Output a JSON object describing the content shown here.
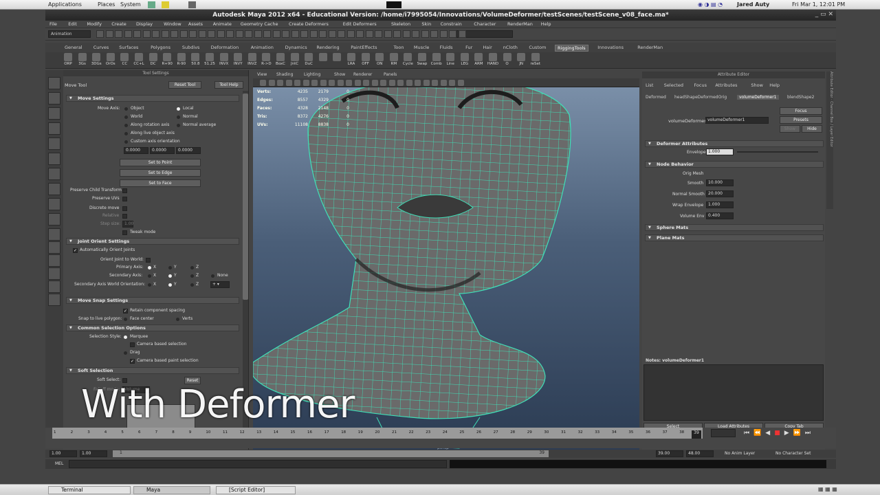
{
  "top_panel": {
    "applications": "Applications",
    "places": "Places",
    "system": "System",
    "user": "Jared Auty",
    "clock": "Fri Mar 1, 12:01 PM"
  },
  "window": {
    "title": "Autodesk Maya 2012 x64 - Educational Version: /home/i7995054/Innovations/VolumeDeformer/testScenes/testScene_v08_face.ma*"
  },
  "menu": [
    "File",
    "Edit",
    "Modify",
    "Create",
    "Display",
    "Window",
    "Assets",
    "Animate",
    "Geometry Cache",
    "Create Deformers",
    "Edit Deformers",
    "Skeleton",
    "Skin",
    "Constrain",
    "Character",
    "RenderMan",
    "Help"
  ],
  "status": {
    "mode": "Animation"
  },
  "shelf_tabs": [
    "General",
    "Curves",
    "Surfaces",
    "Polygons",
    "Subdivs",
    "Deformation",
    "Animation",
    "Dynamics",
    "Rendering",
    "PaintEffects",
    "Toon",
    "Muscle",
    "Fluids",
    "Fur",
    "Hair",
    "nCloth",
    "Custom",
    "RiggingTools",
    "Innovations",
    "RenderMan"
  ],
  "shelf_active": "RiggingTools",
  "shelf_items": [
    "ORP",
    "3Gs",
    "3DGs",
    "OrOs",
    "CC",
    "CC+L",
    "DC",
    "R+90",
    "R-90",
    "50.8",
    "51.25",
    "INVX",
    "INVY",
    "INVZ",
    "R->D",
    "BoxC",
    "JntC",
    "DuC",
    "",
    "",
    "LRA",
    "OFF",
    "ON",
    "RM",
    "Cycle",
    "Swap",
    "Comb",
    "Line",
    "LEG",
    "ARM",
    "HAND",
    "O",
    "JN",
    "reSet"
  ],
  "tool_settings": {
    "panel_title": "Tool Settings",
    "tool_name": "Move Tool",
    "reset": "Reset Tool",
    "help": "Tool Help",
    "move_settings": "Move Settings",
    "move_axis": "Move Axis:",
    "axes": [
      "Object",
      "Local",
      "World",
      "Normal",
      "Along rotation axis",
      "Normal average",
      "Along live object axis",
      "Custom axis orientation"
    ],
    "vals": [
      "0.0000",
      "0.0000",
      "0.0000"
    ],
    "set_points": "Set to Point",
    "set_edge": "Set to Edge",
    "set_face": "Set to Face",
    "preserve_child": "Preserve Child Transform",
    "preserve_uvs": "Preserve UVs",
    "discrete": "Discrete move",
    "relative": "Relative",
    "step_size": "Step size:",
    "step_val": "1.00",
    "tweak": "Tweak mode",
    "joint_orient": "Joint Orient Settings",
    "auto_orient": "Automatically Orient Joints",
    "orient_world": "Orient Joint to World:",
    "primary": "Primary Axis:",
    "secondary": "Secondary Axis:",
    "sec_world": "Secondary Axis World Orientation:",
    "x": "X",
    "y": "Y",
    "z": "Z",
    "none": "None",
    "move_snap": "Move Snap Settings",
    "retain": "Retain component spacing",
    "snap_live": "Snap to live polygon:",
    "face_center": "Face center",
    "verts": "Verts",
    "common_sel": "Common Selection Options",
    "sel_style": "Selection Style:",
    "marquee": "Marquee",
    "cam_sel": "Camera based selection",
    "drag": "Drag",
    "cam_paint": "Camera based paint selection",
    "soft_sel": "Soft Selection",
    "soft_select": "Soft Select:",
    "reset_btn": "Reset",
    "falloff_mode": "Falloff mode:",
    "falloff_val": "Volume"
  },
  "viewport": {
    "menu": [
      "View",
      "Shading",
      "Lighting",
      "Show",
      "Renderer",
      "Panels"
    ],
    "hud": [
      [
        "Verts:",
        "4235",
        "2179",
        "0"
      ],
      [
        "Edges:",
        "8557",
        "4329",
        "0"
      ],
      [
        "Faces:",
        "4328",
        "2148",
        "0"
      ],
      [
        "Tris:",
        "8372",
        "4276",
        "0"
      ],
      [
        "UVs:",
        "11108",
        "8838",
        "0"
      ]
    ],
    "persp": "persp"
  },
  "attr": {
    "title": "Attribute Editor",
    "menu": [
      "List",
      "Selected",
      "Focus",
      "Attributes",
      "Show",
      "Help"
    ],
    "tabs": [
      "Deformed",
      "headShapeDeformedOrig",
      "volumeDeformer1",
      "blendShape2"
    ],
    "active_tab": "volumeDeformer1",
    "node_label": "volumeDeformer:",
    "node_val": "volumeDeformer1",
    "focus": "Focus",
    "presets": "Presets",
    "show": "Show",
    "hide": "Hide",
    "def_attrs": "Deformer Attributes",
    "envelope": "Envelope",
    "envelope_val": "1.000",
    "node_behavior": "Node Behavior",
    "orig_mesh": "Orig Mesh",
    "fields": [
      [
        "Smooth",
        "10.000"
      ],
      [
        "Normal Smooth",
        "20.000"
      ],
      [
        "Wrap Envelope",
        "1.000"
      ],
      [
        "Volume Env",
        "0.400"
      ]
    ],
    "sphere": "Sphere Mats",
    "plane": "Plane Mats",
    "notes": "Notes:  volumeDeformer1",
    "select": "Select",
    "load": "Load Attributes",
    "copy": "Copy Tab"
  },
  "timeline": {
    "ticks": [
      "1",
      "2",
      "3",
      "4",
      "5",
      "6",
      "7",
      "8",
      "9",
      "10",
      "11",
      "12",
      "13",
      "14",
      "15",
      "16",
      "17",
      "18",
      "19",
      "20",
      "21",
      "22",
      "23",
      "24",
      "25",
      "26",
      "27",
      "28",
      "29",
      "30",
      "31",
      "32",
      "33",
      "34",
      "35",
      "36",
      "37",
      "38"
    ],
    "current": "39",
    "start": "1.00",
    "start2": "1.00",
    "slider": "1",
    "end": "39",
    "end2": "39.00",
    "end3": "48.00",
    "anim_layer": "No Anim Layer",
    "char_set": "No Character Set"
  },
  "cmd": {
    "mel": "MEL"
  },
  "overlay": "With Deformer",
  "taskbar": [
    "Terminal",
    "Maya",
    "[Script Editor]"
  ]
}
